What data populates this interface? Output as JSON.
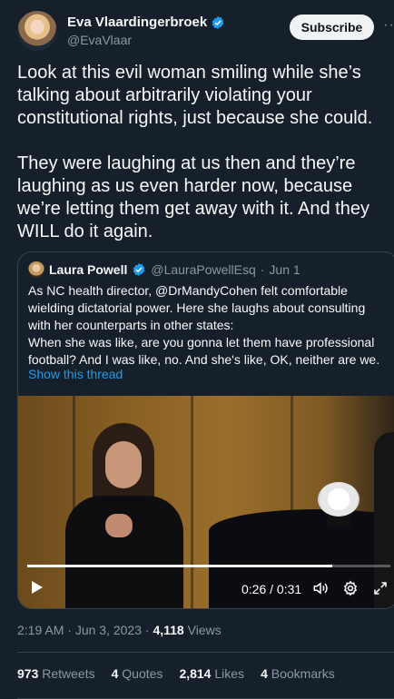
{
  "author": {
    "display_name": "Eva Vlaardingerbroek",
    "handle": "@EvaVlaar",
    "verified": true,
    "subscribe_label": "Subscribe",
    "more_label": "··"
  },
  "tweet": {
    "paragraph_1": "Look at this evil woman smiling while she’s talking about arbitrarily violating your constitutional rights, just because she could.",
    "paragraph_2": "They were laughing at us then and they’re laughing as us even harder now, because we’re letting them get away with it. And they WILL do it again."
  },
  "quote": {
    "display_name": "Laura Powell",
    "handle": "@LauraPowellEsq",
    "separator": "·",
    "date": "Jun 1",
    "text": "As NC health director, @DrMandyCohen felt comfortable wielding dictatorial power. Here she laughs about consulting with her counterparts in other states:\nWhen she was like, are you gonna let them have professional football? And I was like, no. And she's like, OK, neither are we.",
    "show_thread": "Show this thread",
    "video": {
      "time": "0:26 / 0:31",
      "progress": 0.84
    }
  },
  "meta": {
    "time": "2:19 AM",
    "date": "Jun 3, 2023",
    "separator": "·",
    "views_count": "4,118",
    "views_label": "Views"
  },
  "stats": {
    "retweets_count": "973",
    "retweets_label": "Retweets",
    "quotes_count": "4",
    "quotes_label": "Quotes",
    "likes_count": "2,814",
    "likes_label": "Likes",
    "bookmarks_count": "4",
    "bookmarks_label": "Bookmarks"
  },
  "colors": {
    "background": "#15202b",
    "accent": "#1d9bf0",
    "text": "#f7f9f9",
    "muted": "#8b98a5",
    "border": "#38444d"
  },
  "icons": [
    "verified-icon",
    "play-icon",
    "volume-icon",
    "settings-icon",
    "fullscreen-icon"
  ]
}
